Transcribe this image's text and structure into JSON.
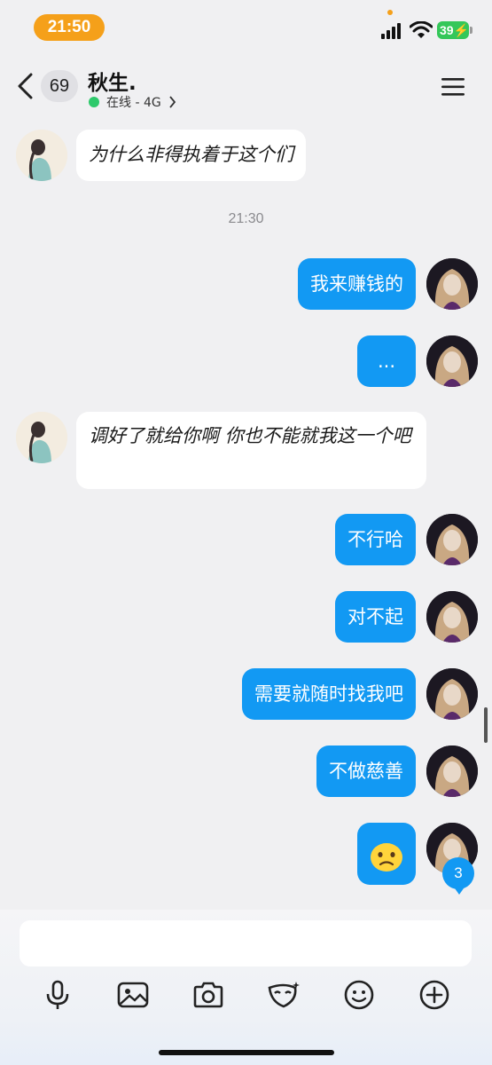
{
  "status_bar": {
    "time": "21:50",
    "battery": "39"
  },
  "header": {
    "unread_count": "69",
    "contact_name": "秋生.",
    "status": "在线 - 4G"
  },
  "messages": [
    {
      "side": "left",
      "text": "为什么非得执着于这个们"
    },
    {
      "type": "time",
      "text": "21:30"
    },
    {
      "side": "right",
      "text": "我来赚钱的"
    },
    {
      "side": "right",
      "text": "..."
    },
    {
      "side": "left",
      "text": "调好了就给你啊 你也不能就我这一个吧"
    },
    {
      "side": "right",
      "text": "不行哈"
    },
    {
      "side": "right",
      "text": "对不起"
    },
    {
      "side": "right",
      "text": "需要就随时找我吧"
    },
    {
      "side": "right",
      "text": "不做慈善"
    },
    {
      "side": "right",
      "emoji": "confused-face"
    }
  ],
  "unread_badge": "3",
  "toolbar": [
    "mic-icon",
    "image-icon",
    "camera-icon",
    "mask-icon",
    "emoji-icon",
    "plus-icon"
  ],
  "colors": {
    "bubble_right": "#1299f3",
    "time_pill": "#f5a01a",
    "online": "#2ec96b"
  }
}
